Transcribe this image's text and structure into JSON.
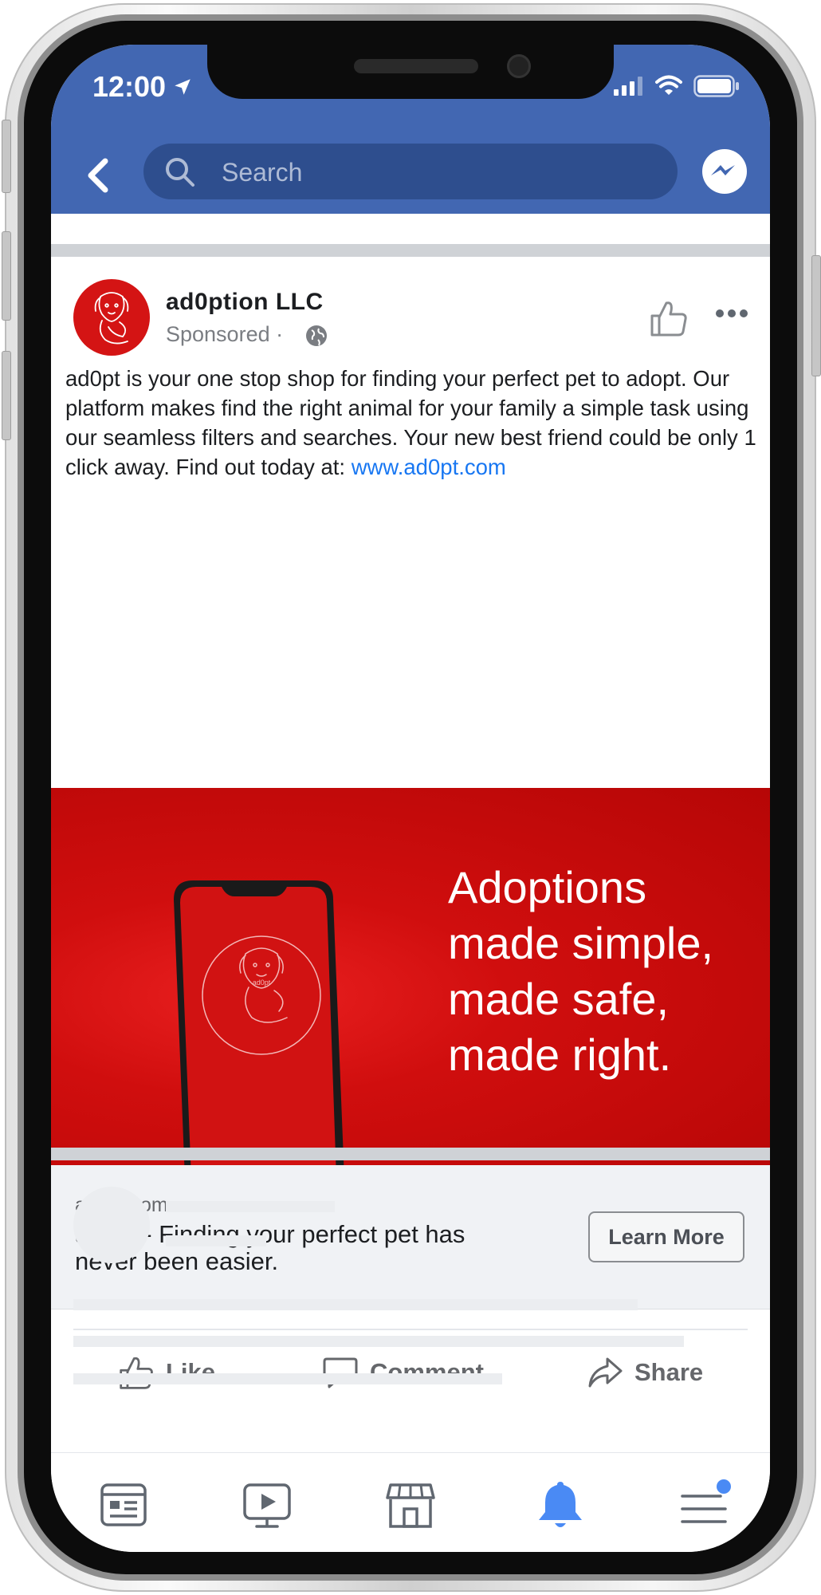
{
  "status_bar": {
    "time": "12:00"
  },
  "search": {
    "placeholder": "Search"
  },
  "post": {
    "page_name": "ad0ption LLC",
    "sponsored_label": "Sponsored ·",
    "body_text": "ad0pt is your one stop shop for finding your perfect pet to adopt. Our platform makes find the right animal for your family a simple task using our seamless filters and searches. Your new best friend could be only 1 click away. Find out today at: ",
    "body_link": "www.ad0pt.com",
    "banner": {
      "lines": [
        "Adoptions",
        "made simple,",
        "made safe,",
        "made right."
      ],
      "phone_logo_text": "ad0pt"
    },
    "link_preview": {
      "domain": "ad0pt.com",
      "title": "ad0pt - Finding your perfect pet has never been easier.",
      "cta": "Learn More"
    },
    "actions": {
      "like": "Like",
      "comment": "Comment",
      "share": "Share"
    }
  },
  "bottom_nav": {
    "items": [
      "news-feed",
      "watch",
      "marketplace",
      "notifications",
      "menu"
    ],
    "active": "notifications"
  },
  "colors": {
    "facebook_blue": "#4267b2",
    "banner_red": "#d00e0e",
    "link_blue": "#1877f2",
    "active_nav": "#4a8af4"
  },
  "icons": [
    "location-arrow-icon",
    "signal-icon",
    "wifi-icon",
    "battery-icon",
    "back-arrow-icon",
    "search-icon",
    "messenger-icon",
    "globe-icon",
    "thumbs-up-icon",
    "more-icon",
    "comment-icon",
    "share-icon",
    "news-feed-icon",
    "watch-icon",
    "marketplace-icon",
    "bell-icon",
    "menu-icon"
  ]
}
